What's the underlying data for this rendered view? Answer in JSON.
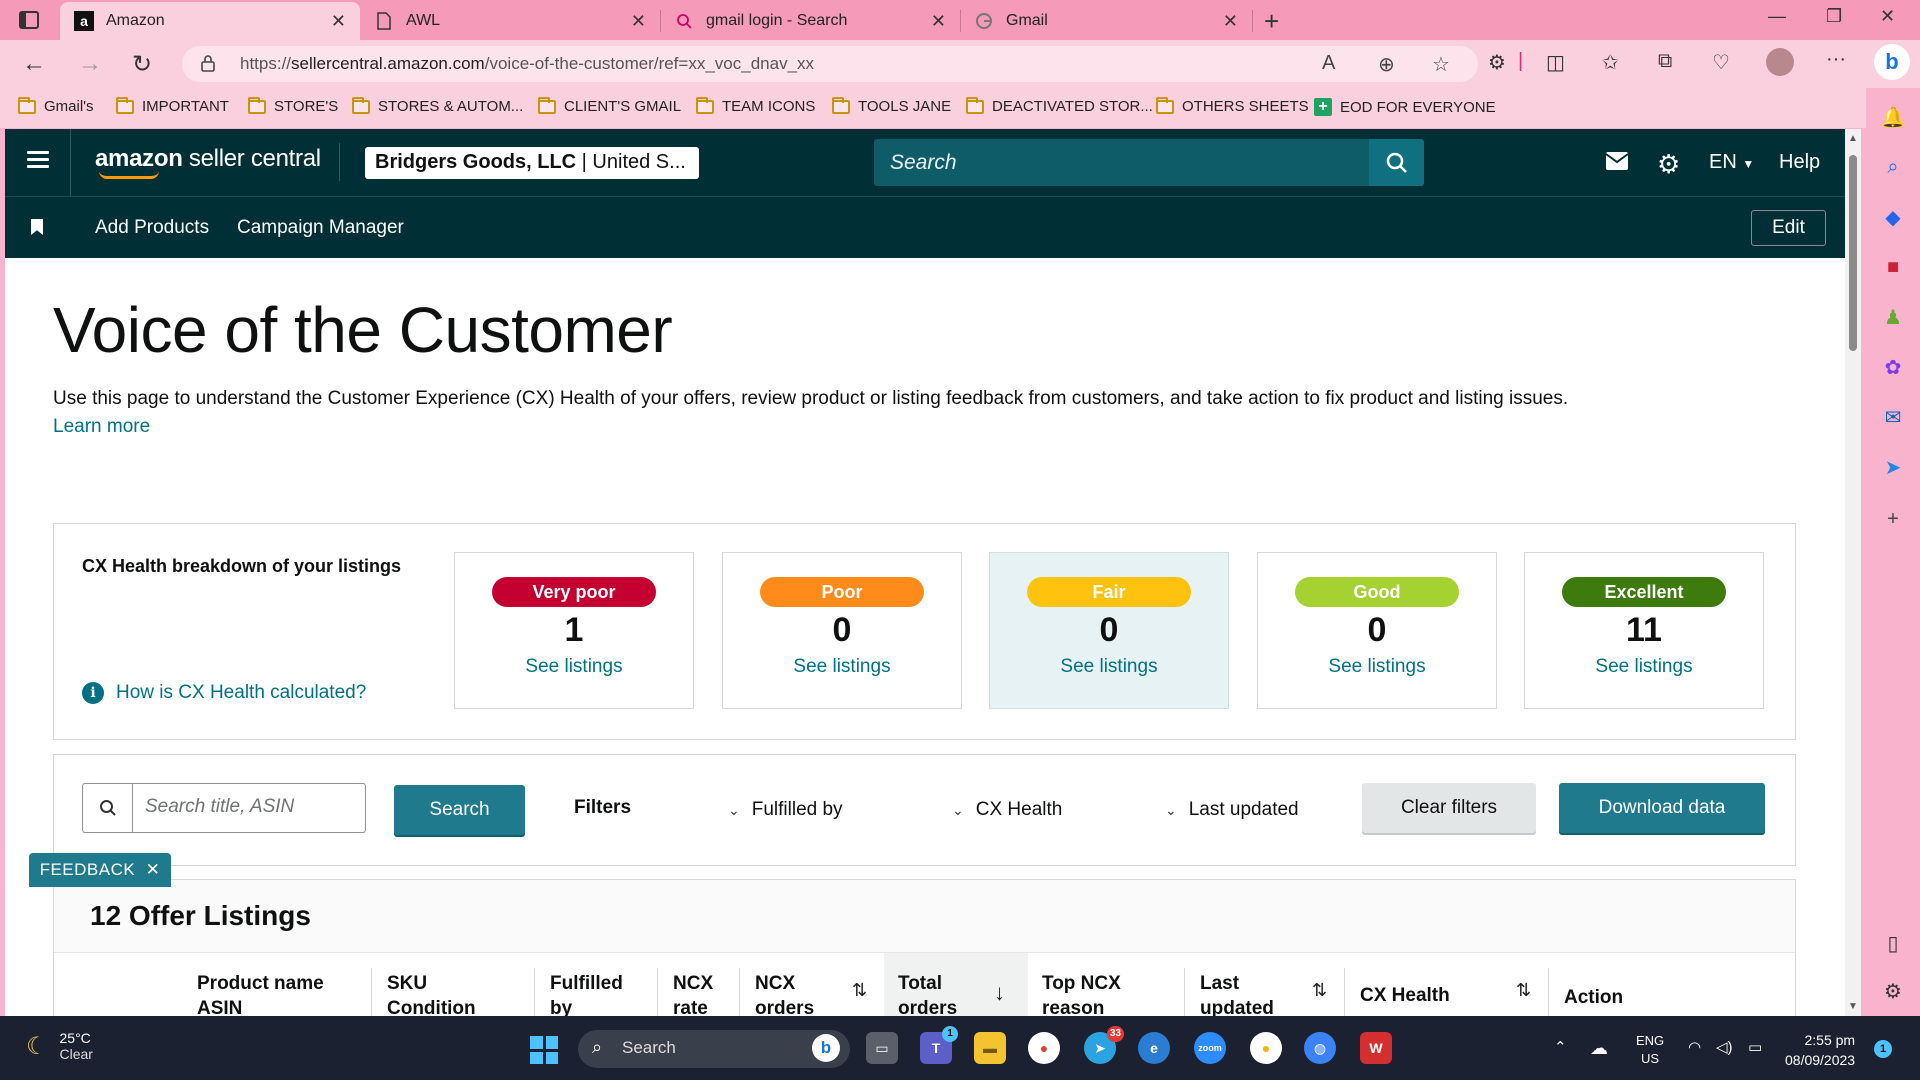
{
  "browser": {
    "tabs": [
      {
        "title": "Amazon",
        "favicon": "a"
      },
      {
        "title": "AWL",
        "favicon": "document-icon"
      },
      {
        "title": "gmail login - Search",
        "favicon": "search-icon"
      },
      {
        "title": "Gmail",
        "favicon": "google-icon"
      }
    ],
    "url_prefix": "https://",
    "url_domain": "sellercentral.amazon.com",
    "url_path": "/voice-of-the-customer/ref=xx_voc_dnav_xx",
    "bookmarks": [
      {
        "label": "Gmail's",
        "type": "folder"
      },
      {
        "label": "IMPORTANT",
        "type": "folder"
      },
      {
        "label": "STORE'S",
        "type": "folder"
      },
      {
        "label": "STORES & AUTOM...",
        "type": "folder"
      },
      {
        "label": "CLIENT'S GMAIL",
        "type": "folder"
      },
      {
        "label": "TEAM ICONS",
        "type": "folder"
      },
      {
        "label": "TOOLS JANE",
        "type": "folder"
      },
      {
        "label": "DEACTIVATED STOR...",
        "type": "folder"
      },
      {
        "label": "OTHERS SHEETS",
        "type": "folder"
      },
      {
        "label": "EOD FOR EVERYONE",
        "type": "sheet"
      }
    ]
  },
  "header": {
    "logo_bold": "amazon",
    "logo_rest": " seller central",
    "account_bold": "Bridgers Goods, LLC",
    "account_rest": " | United S...",
    "search_placeholder": "Search",
    "language": "EN",
    "help": "Help"
  },
  "subnav": {
    "items": [
      "Add Products",
      "Campaign Manager"
    ],
    "edit": "Edit"
  },
  "page": {
    "title": "Voice of the Customer",
    "description": "Use this page to understand the Customer Experience (CX) Health of your offers, review product or listing feedback from customers, and take action to fix product and listing issues.",
    "learn_more": "Learn more"
  },
  "cx_health": {
    "title": "CX Health breakdown of your listings",
    "how_link": "How is CX Health calculated?",
    "tiles": [
      {
        "label": "Very poor",
        "count": "1",
        "link": "See listings",
        "color": "#c40030"
      },
      {
        "label": "Poor",
        "count": "0",
        "link": "See listings",
        "color": "#ff8c1a"
      },
      {
        "label": "Fair",
        "count": "0",
        "link": "See listings",
        "color": "#ffc20e"
      },
      {
        "label": "Good",
        "count": "0",
        "link": "See listings",
        "color": "#a6d231"
      },
      {
        "label": "Excellent",
        "count": "11",
        "link": "See listings",
        "color": "#3e7b0f"
      }
    ]
  },
  "filters": {
    "search_placeholder": "Search title, ASIN",
    "search_button": "Search",
    "label": "Filters",
    "dropdowns": [
      "Fulfilled by",
      "CX Health",
      "Last updated"
    ],
    "clear": "Clear filters",
    "download": "Download data"
  },
  "listings": {
    "title": "12 Offer Listings",
    "columns": [
      {
        "l1": "Product name",
        "l2": "ASIN"
      },
      {
        "l1": "SKU",
        "l2": "Condition"
      },
      {
        "l1": "Fulfilled",
        "l2": "by"
      },
      {
        "l1": "NCX",
        "l2": "rate"
      },
      {
        "l1": "NCX",
        "l2": "orders"
      },
      {
        "l1": "Total",
        "l2": "orders"
      },
      {
        "l1": "Top NCX",
        "l2": "reason"
      },
      {
        "l1": "Last",
        "l2": "updated"
      },
      {
        "l1": "CX Health",
        "l2": ""
      },
      {
        "l1": "Action",
        "l2": ""
      }
    ]
  },
  "feedback": "FEEDBACK",
  "taskbar": {
    "temp": "25°C",
    "weather": "Clear",
    "search": "Search",
    "lang1": "ENG",
    "lang2": "US",
    "time": "2:55 pm",
    "date": "08/09/2023",
    "notif_count": "1",
    "teams_badge": "1",
    "telegram_badge": "33"
  },
  "colors": {
    "header_bg": "#002f36",
    "link": "#007185",
    "primary_button": "#1e7a8c"
  }
}
